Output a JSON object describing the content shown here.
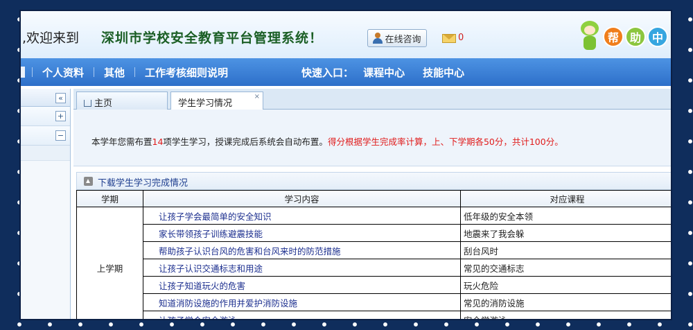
{
  "header": {
    "welcome": ",欢迎来到",
    "system_title": "深圳市学校安全教育平台管理系统！",
    "consult_button": "在线咨询",
    "mail_count": "0",
    "help_chars": [
      "帮",
      "助",
      "中"
    ]
  },
  "nav": {
    "items": [
      "个人资料",
      "其他",
      "工作考核细则说明"
    ],
    "quick_label": "快速入口：",
    "quick_links": [
      "课程中心",
      "技能中心"
    ]
  },
  "sidebar": {
    "collapse_symbol": "«",
    "expand_symbol": "+",
    "minus_symbol": "−"
  },
  "tabs": [
    {
      "label": "主页"
    },
    {
      "label": "学生学习情况",
      "close": "×"
    }
  ],
  "info": {
    "part1": "本学年您需布置",
    "count": "14",
    "part2": "项学生学习，授课完成后系统会自动布置。",
    "notice": "得分根据学生完成率计算，上、下学期各50分，共计100分。"
  },
  "download_link": "下载学生学习完成情况",
  "table": {
    "headers": [
      "学期",
      "学习内容",
      "对应课程"
    ],
    "term": "上学期",
    "rows": [
      {
        "content": "让孩子学会最简单的安全知识",
        "course": "低年级的安全本领"
      },
      {
        "content": "家长带领孩子训练避震技能",
        "course": "地震来了我会躲"
      },
      {
        "content": "帮助孩子认识台风的危害和台风来时的防范措施",
        "course": "刮台风时"
      },
      {
        "content": "让孩子认识交通标志和用途",
        "course": "常见的交通标志"
      },
      {
        "content": "让孩子知道玩火的危害",
        "course": "玩火危险"
      },
      {
        "content": "知道消防设施的作用并爱护消防设施",
        "course": "常见的消防设施"
      },
      {
        "content": "让孩子学会安全游泳",
        "course": "安全学游泳"
      }
    ]
  },
  "colors": {
    "nav_blue": "#2d6fc9",
    "title_green": "#1a5e24",
    "alert_red": "#e01b1b",
    "link_blue": "#1c2f8f",
    "help_circle_1": "#f07e1c",
    "help_circle_2": "#8cc63f",
    "help_circle_3": "#36a6e0"
  }
}
